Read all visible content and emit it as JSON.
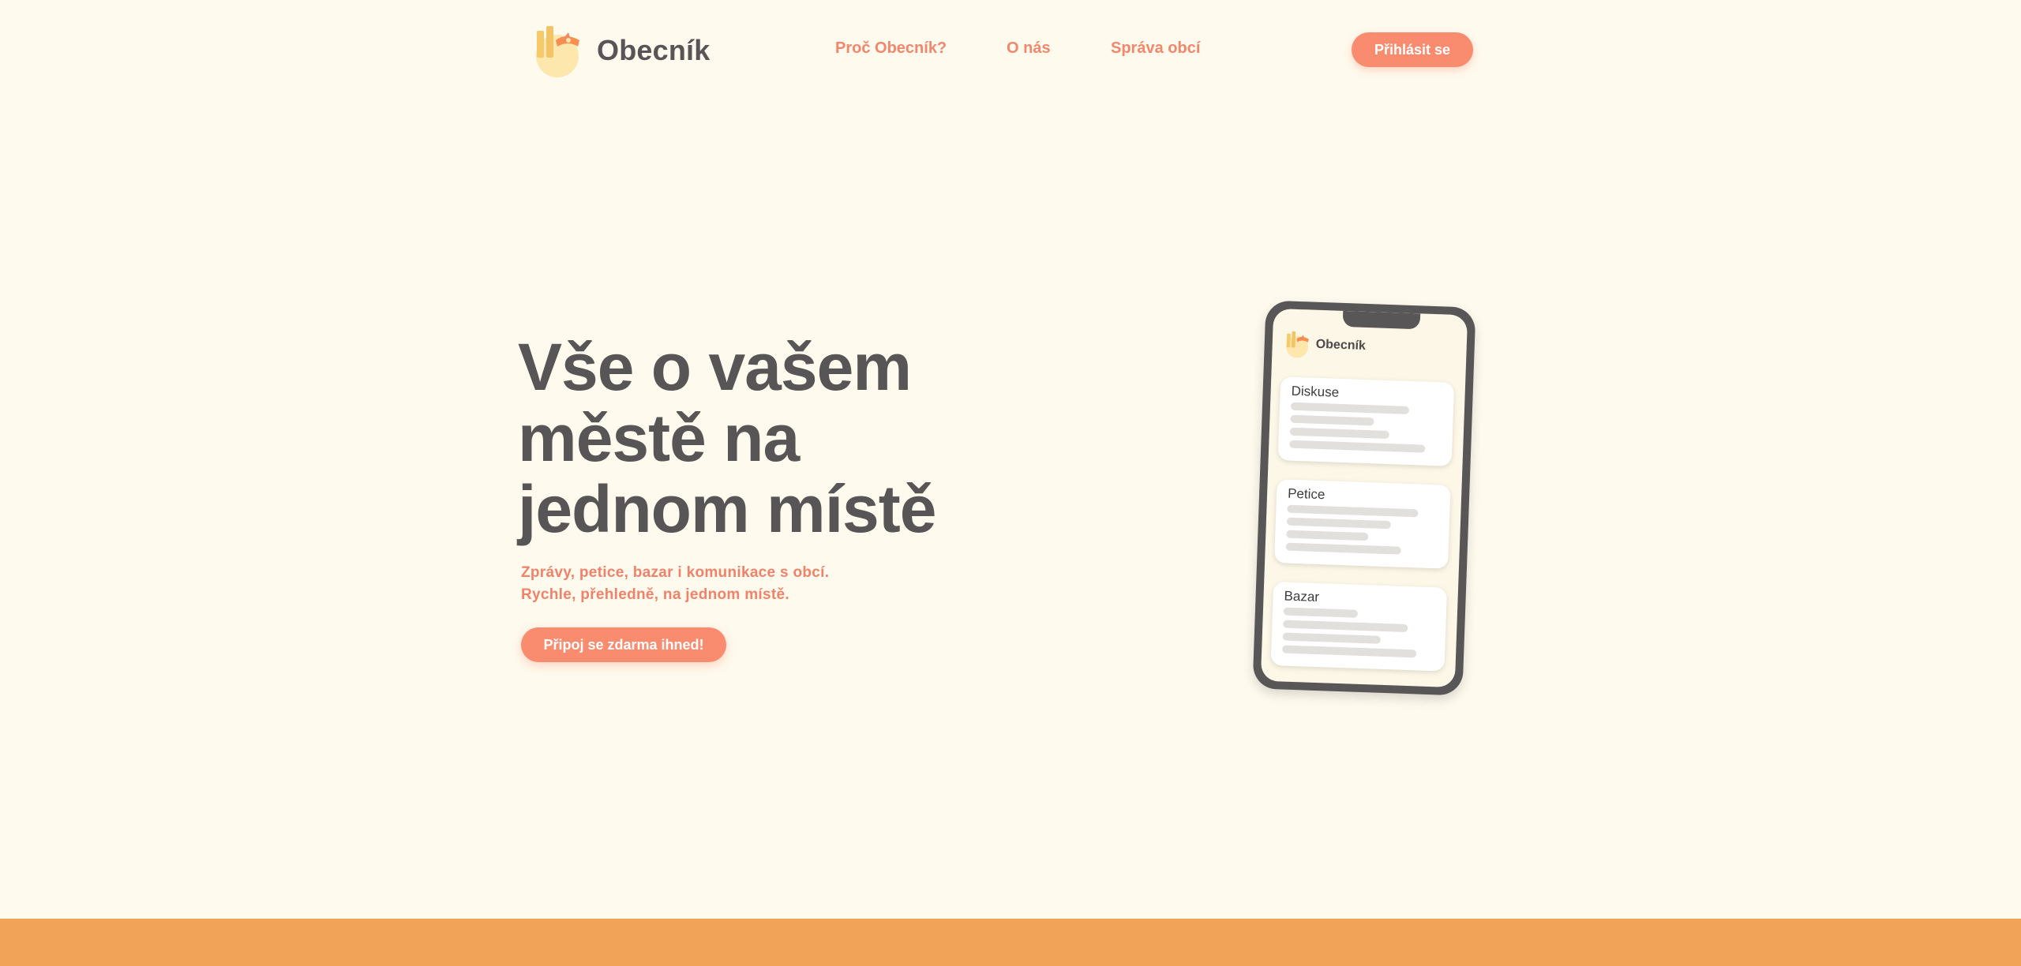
{
  "header": {
    "brand": "Obecník",
    "nav": [
      {
        "label": "Proč Obecník?"
      },
      {
        "label": "O nás"
      },
      {
        "label": "Správa obcí"
      }
    ],
    "login_label": "Přihlásit se"
  },
  "hero": {
    "title_lines": [
      "Vše o vašem",
      "městě na",
      "jednom místě"
    ],
    "subtitle_lines": [
      "Zprávy, petice, bazar i komunikace s obcí.",
      "Rychle, přehledně, na jednom místě."
    ],
    "cta_label": "Připoj se zdarma ihned!"
  },
  "phone": {
    "brand": "Obecník",
    "cards": [
      {
        "title": "Diskuse"
      },
      {
        "title": "Petice"
      },
      {
        "title": "Bazar"
      }
    ]
  },
  "colors": {
    "background": "#fefaee",
    "accent": "#f98b6e",
    "text": "#575555",
    "footer": "#f1a358"
  }
}
